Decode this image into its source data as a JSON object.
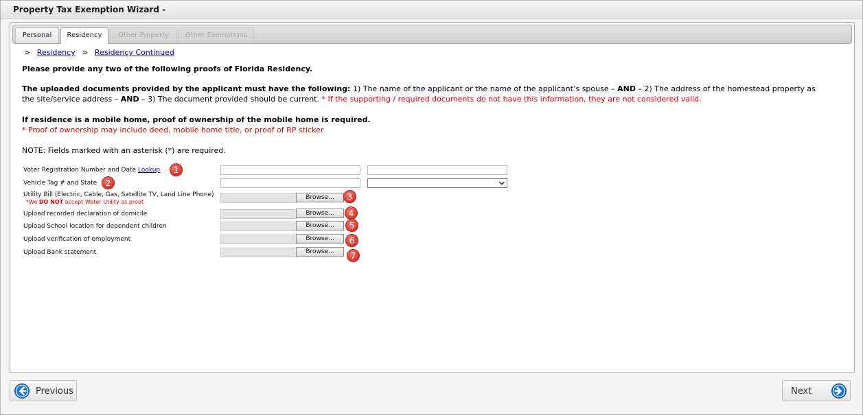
{
  "window": {
    "title": "Property Tax Exemption Wizard -"
  },
  "tabs": [
    {
      "label": "Personal",
      "state": "normal"
    },
    {
      "label": "Residency",
      "state": "active"
    },
    {
      "label": "Other Property",
      "state": "disabled"
    },
    {
      "label": "Other Exemptions",
      "state": "disabled"
    }
  ],
  "breadcrumb": {
    "sep": ">",
    "items": [
      "Residency",
      "Residency Continued"
    ]
  },
  "instructions": {
    "intro": "Please provide any two of the following proofs of Florida Residency.",
    "requirements_bold": "The uploaded documents provided by the applicant must have the following:",
    "req_1": " 1) The name of the applicant or the name of the applicant’s spouse – ",
    "and_1": "AND",
    "req_2": " – 2) The address of the homestead property as the site/service address – ",
    "and_2": "AND",
    "req_3": " – 3) The document provided should be current. ",
    "req_warning": "* If the supporting / required documents do not have this information, they are not considered valid.",
    "mobile_home": "If residence is a mobile home, proof of ownership of the mobile home is required.",
    "mobile_home_note": "* Proof of ownership may include deed, mobile home title, or proof of RP sticker",
    "note": "NOTE: Fields marked with an asterisk (*) are required."
  },
  "fields": {
    "voter": {
      "label": "Voter Registration Number and Date",
      "link": "Lookup",
      "badge": "1",
      "value1": "",
      "value2": ""
    },
    "vehicle": {
      "label": "Vehicle Tag # and State",
      "badge": "2",
      "value": "",
      "state_selected": ""
    },
    "utility": {
      "label": "Utility Bill (Electric, Cable, Gas, Satellite TV, Land Line Phone)",
      "note_pre": "*We ",
      "note_bold": "DO NOT",
      "note_post": " accept Water Utility as proof.",
      "browse": "Browse...",
      "badge": "3"
    },
    "domicile": {
      "label": "Upload recorded declaration of domicile",
      "browse": "Browse...",
      "badge": "4"
    },
    "school": {
      "label": "Upload School location for dependent children",
      "browse": "Browse...",
      "badge": "5"
    },
    "employment": {
      "label": "Upload verification of employment",
      "browse": "Browse...",
      "badge": "6"
    },
    "bank": {
      "label": "Upload Bank statement",
      "browse": "Browse...",
      "badge": "7"
    }
  },
  "nav": {
    "previous": "Previous",
    "next": "Next"
  },
  "colors": {
    "badge": "#d9332c",
    "nav_icon": "#1a73d9",
    "link": "#0000cc",
    "warning": "#e00000"
  }
}
